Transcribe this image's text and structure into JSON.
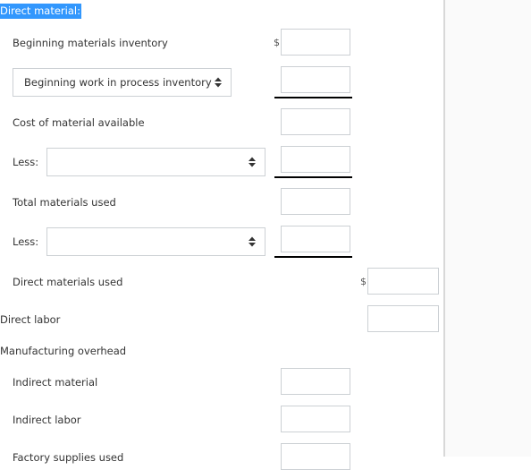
{
  "section_heading": "Direct material:",
  "rows": {
    "beginning_materials_inventory": "Beginning materials inventory",
    "beginning_wip_select": "Beginning work in process inventory",
    "cost_of_material_available": "Cost of material available",
    "less_1_label": "Less:",
    "less_1_select": "",
    "total_materials_used": "Total materials used",
    "less_2_label": "Less:",
    "less_2_select": "",
    "direct_materials_used": "Direct materials used",
    "direct_labor": "Direct labor",
    "manufacturing_overhead": "Manufacturing overhead",
    "indirect_material": "Indirect material",
    "indirect_labor": "Indirect labor",
    "factory_supplies_used": "Factory supplies used"
  },
  "currency_symbol": "$",
  "inputs": {
    "beginning_materials_inventory": "",
    "beginning_wip": "",
    "cost_of_material_available": "",
    "less_1": "",
    "total_materials_used": "",
    "less_2": "",
    "direct_materials_used": "",
    "direct_labor": "",
    "indirect_material": "",
    "indirect_labor": "",
    "factory_supplies_used": ""
  },
  "icons": {
    "select_arrow": "up-down-caret-icon"
  }
}
